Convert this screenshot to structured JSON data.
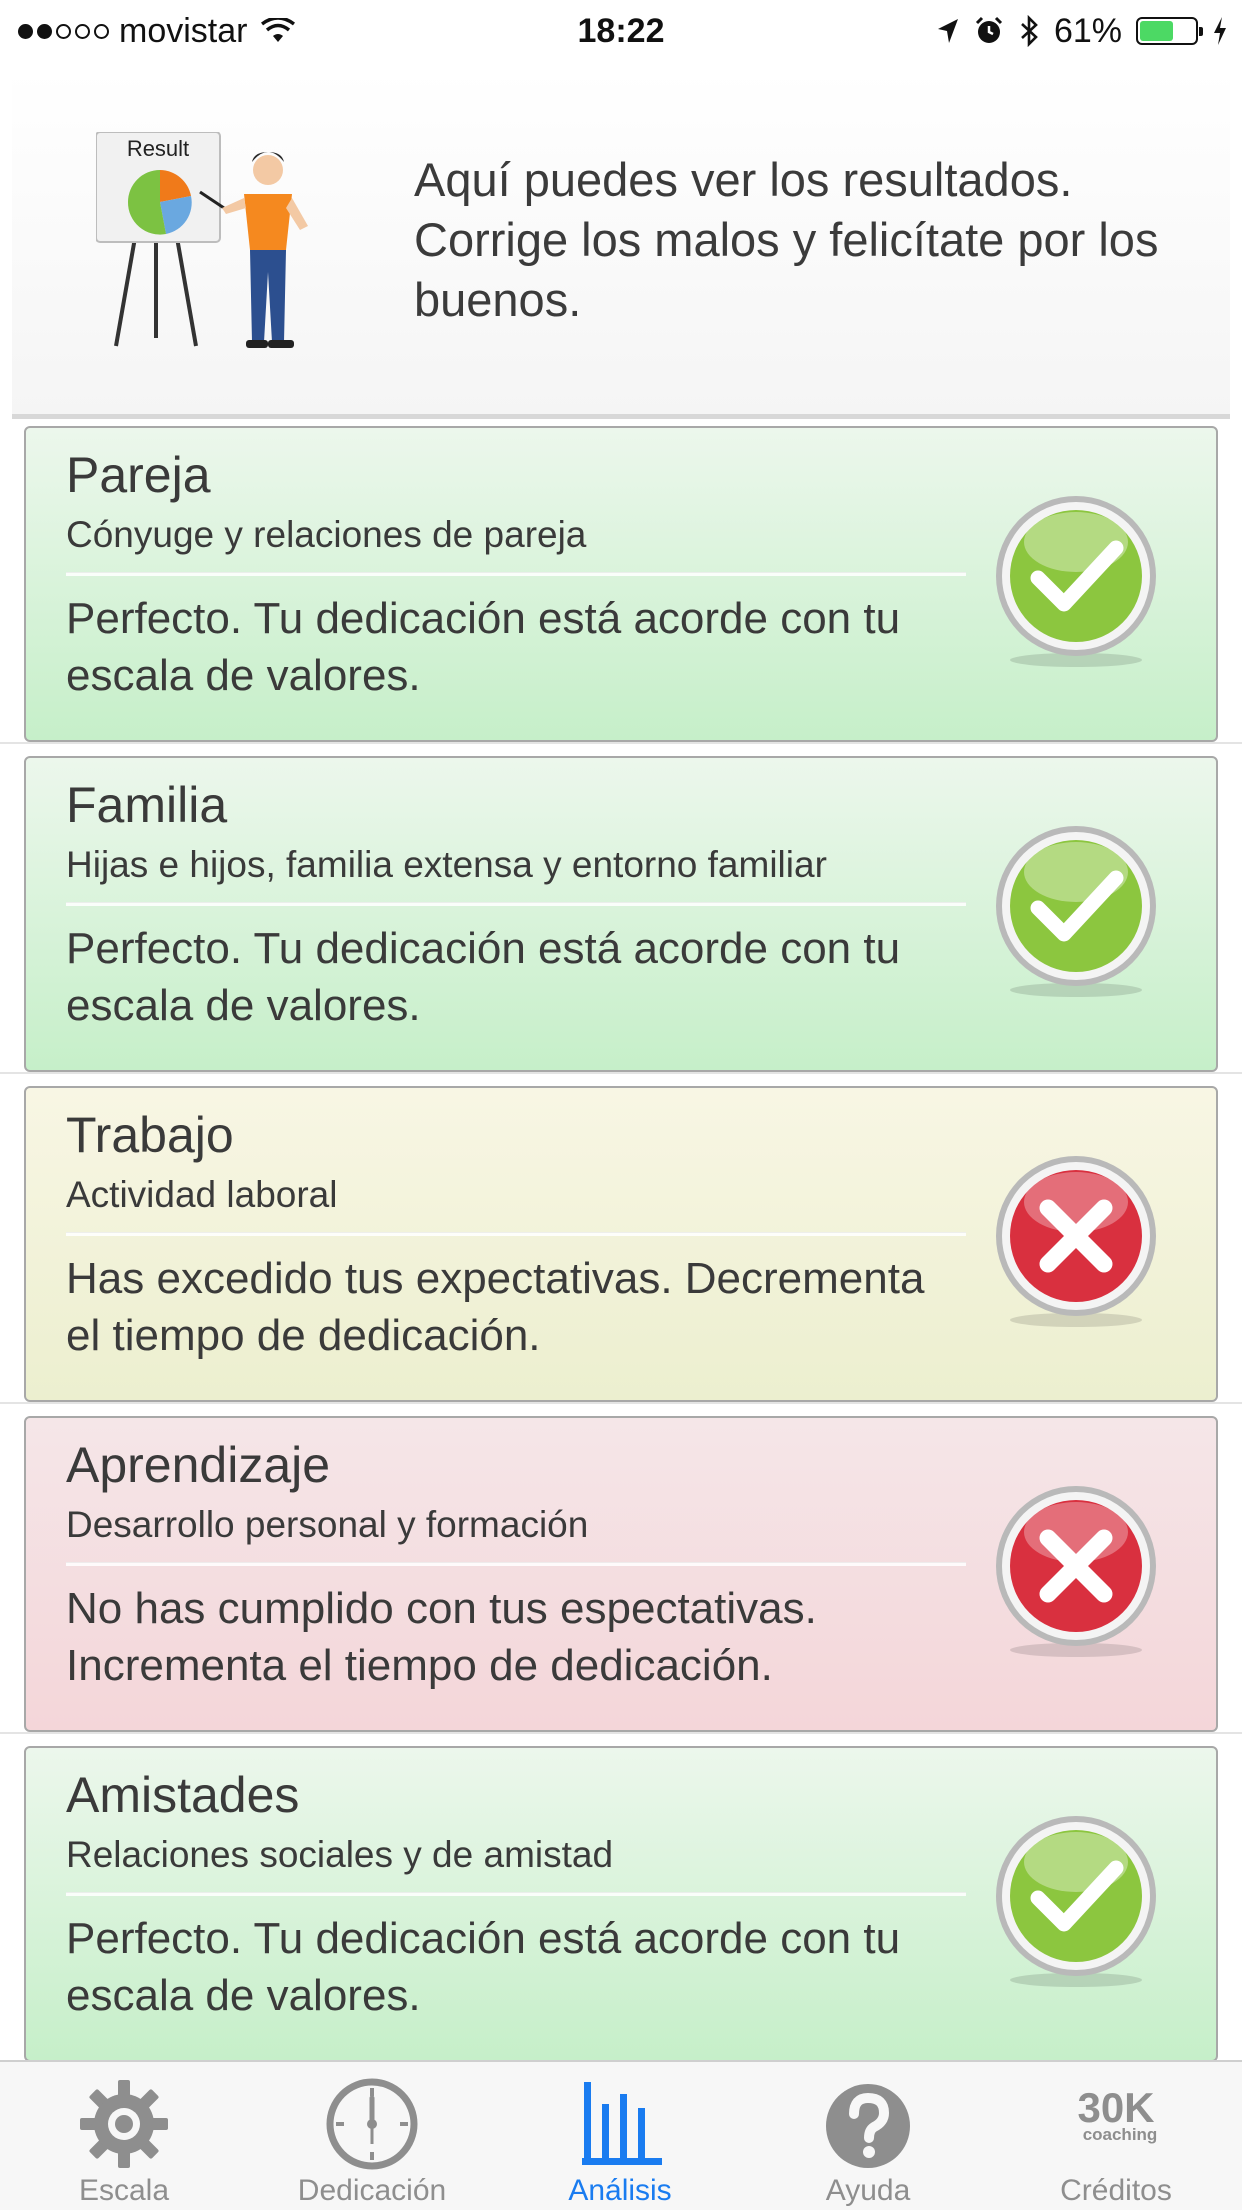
{
  "status_bar": {
    "carrier": "movistar",
    "time": "18:22",
    "battery": "61%",
    "battery_level": 0.61
  },
  "header": {
    "illustration_label": "Result",
    "message": "Aquí puedes ver los resultados. Corrige los malos y felicítate por los buenos."
  },
  "results": [
    {
      "title": "Pareja",
      "subtitle": "Cónyuge y relaciones de pareja",
      "message": "Perfecto. Tu dedicación está acorde con tu escala de valores.",
      "status": "ok"
    },
    {
      "title": "Familia",
      "subtitle": "Hijas e hijos, familia extensa y entorno familiar",
      "message": "Perfecto. Tu dedicación está acorde con tu escala de valores.",
      "status": "ok"
    },
    {
      "title": "Trabajo",
      "subtitle": "Actividad laboral",
      "message": "Has excedido tus expectativas. Decrementa el tiempo de dedicación.",
      "status": "warn"
    },
    {
      "title": "Aprendizaje",
      "subtitle": "Desarrollo personal y formación",
      "message": "No has cumplido con tus espectativas. Incrementa el tiempo de dedicación.",
      "status": "bad"
    },
    {
      "title": "Amistades",
      "subtitle": "Relaciones sociales y de amistad",
      "message": "Perfecto. Tu dedicación está acorde con tu escala de valores.",
      "status": "ok"
    }
  ],
  "tabs": [
    {
      "label": "Escala",
      "icon": "gear-icon",
      "active": false
    },
    {
      "label": "Dedicación",
      "icon": "clock-icon",
      "active": false
    },
    {
      "label": "Análisis",
      "icon": "bar-chart-icon",
      "active": true
    },
    {
      "label": "Ayuda",
      "icon": "help-icon",
      "active": false
    },
    {
      "label": "Créditos",
      "icon": "coaching-logo-icon",
      "active": false,
      "logo_text": "30K",
      "logo_subtext": "coaching"
    }
  ],
  "colors": {
    "accent": "#1a7cf0",
    "ok_icon": "#8cc63f",
    "bad_icon": "#d9303f",
    "battery": "#4cd964"
  }
}
